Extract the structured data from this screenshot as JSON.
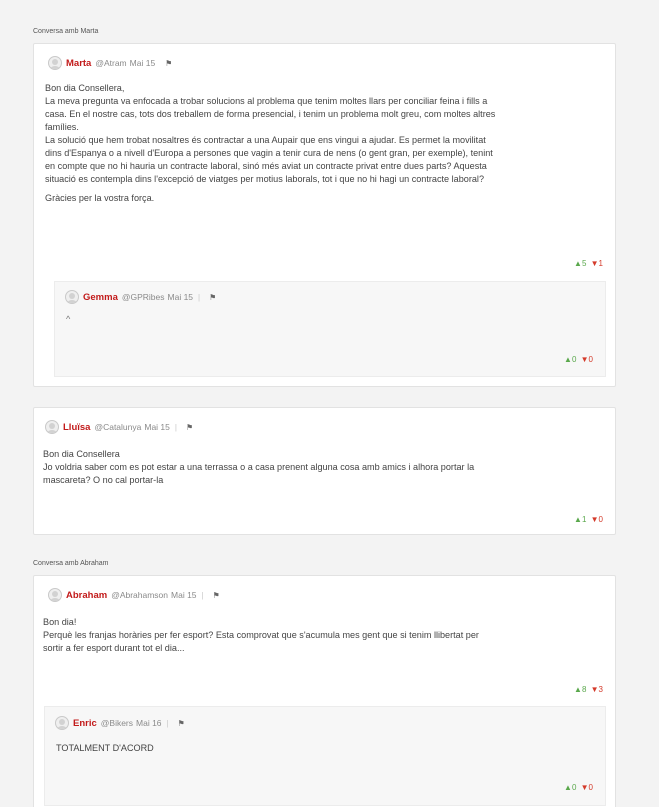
{
  "sections": [
    {
      "label": "Conversa amb Marta"
    },
    {
      "label": "Conversa amb Abraham"
    }
  ],
  "comments": {
    "marta": {
      "author": "Marta",
      "handle": "@Atram",
      "date": "Mai 15",
      "flag_icon": "flag-icon",
      "lines": [
        "Bon dia Consellera,",
        "La meva pregunta va enfocada a trobar solucions al problema que tenim moltes llars per conciliar feina i fills a",
        "casa. En el nostre cas, tots dos treballem de forma presencial, i tenim un problema molt greu, com moltes altres",
        "famílies.",
        "La solució que hem trobat nosaltres és contractar a una Aupair que ens vingui a ajudar. Es permet la movilitat",
        "dins d'Espanya o a nivell d'Europa a persones que vagin a tenir cura de nens (o gent gran, per exemple), tenint",
        "en compte que no hi hauria un contracte laboral, sinó més aviat un contracte privat entre dues parts? Aquesta",
        "situació es contempla dins l'excepció de viatges per motius laborals, tot i que no hi hagi un contracte laboral?"
      ],
      "closing": "Gràcies per la vostra força.",
      "up": "5",
      "down": "1"
    },
    "gemma": {
      "author": "Gemma",
      "handle": "@GPRibes",
      "date": "Mai 15",
      "separator": "|",
      "text": "^",
      "up": "0",
      "down": "0"
    },
    "lluisa": {
      "author": "Lluïsa",
      "handle": "@Catalunya",
      "date": "Mai 15",
      "separator": "|",
      "lines": [
        "Bon dia Consellera",
        "Jo voldria saber com es pot estar a una terrassa o a casa prenent alguna cosa amb amics i alhora portar la",
        "mascareta? O no cal portar-la"
      ],
      "up": "1",
      "down": "0"
    },
    "abraham": {
      "author": "Abraham",
      "handle": "@Abrahamson",
      "date": "Mai 15",
      "separator": "|",
      "lines": [
        "Bon dia!",
        "Perquè les franjas horàries per fer esport? Esta comprovat que s'acumula mes gent que si tenim llibertat per",
        "sortir a fer esport durant tot el dia..."
      ],
      "up": "8",
      "down": "3"
    },
    "enric": {
      "author": "Enric",
      "handle": "@Bikers",
      "date": "Mai 16",
      "separator": "|",
      "text": "TOTALMENT D'ACORD",
      "up": "0",
      "down": "0"
    }
  },
  "icons": {
    "up_arrow": "▲",
    "down_arrow": "▼",
    "flag": "⚑"
  }
}
